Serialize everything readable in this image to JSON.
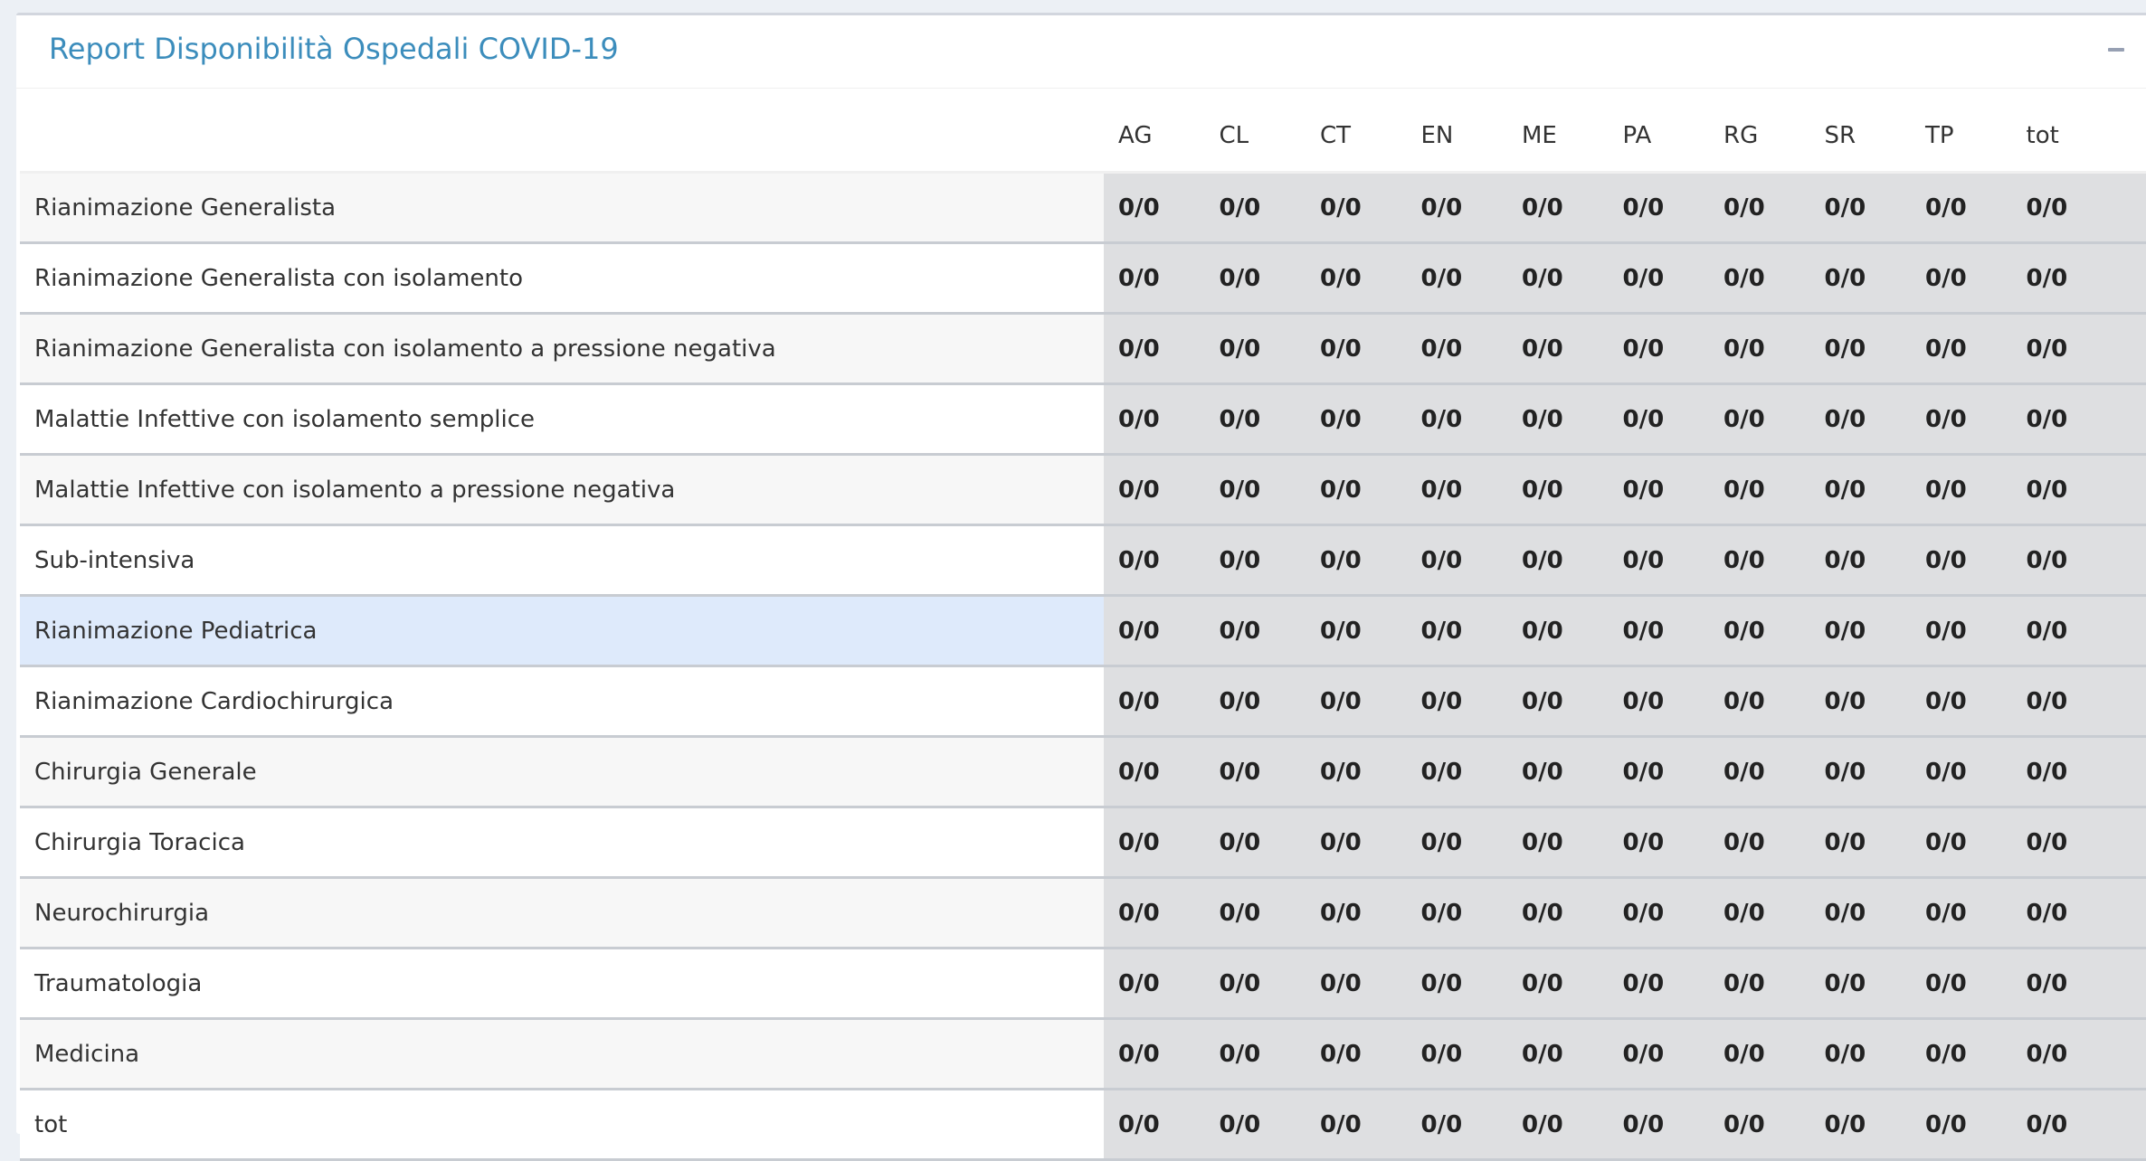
{
  "box": {
    "title": "Report Disponibilità Ospedali COVID-19",
    "collapse_icon": "minus-icon"
  },
  "table": {
    "columns": [
      "AG",
      "CL",
      "CT",
      "EN",
      "ME",
      "PA",
      "RG",
      "SR",
      "TP",
      "tot"
    ],
    "rows": [
      {
        "label": "Rianimazione Generalista",
        "values": [
          "0/0",
          "0/0",
          "0/0",
          "0/0",
          "0/0",
          "0/0",
          "0/0",
          "0/0",
          "0/0",
          "0/0"
        ]
      },
      {
        "label": "Rianimazione Generalista con isolamento",
        "values": [
          "0/0",
          "0/0",
          "0/0",
          "0/0",
          "0/0",
          "0/0",
          "0/0",
          "0/0",
          "0/0",
          "0/0"
        ]
      },
      {
        "label": "Rianimazione Generalista con isolamento a pressione negativa",
        "values": [
          "0/0",
          "0/0",
          "0/0",
          "0/0",
          "0/0",
          "0/0",
          "0/0",
          "0/0",
          "0/0",
          "0/0"
        ]
      },
      {
        "label": "Malattie Infettive con isolamento semplice",
        "values": [
          "0/0",
          "0/0",
          "0/0",
          "0/0",
          "0/0",
          "0/0",
          "0/0",
          "0/0",
          "0/0",
          "0/0"
        ]
      },
      {
        "label": "Malattie Infettive con isolamento a pressione negativa",
        "values": [
          "0/0",
          "0/0",
          "0/0",
          "0/0",
          "0/0",
          "0/0",
          "0/0",
          "0/0",
          "0/0",
          "0/0"
        ]
      },
      {
        "label": "Sub-intensiva",
        "values": [
          "0/0",
          "0/0",
          "0/0",
          "0/0",
          "0/0",
          "0/0",
          "0/0",
          "0/0",
          "0/0",
          "0/0"
        ]
      },
      {
        "label": "Rianimazione Pediatrica",
        "values": [
          "0/0",
          "0/0",
          "0/0",
          "0/0",
          "0/0",
          "0/0",
          "0/0",
          "0/0",
          "0/0",
          "0/0"
        ],
        "highlighted": true
      },
      {
        "label": "Rianimazione Cardiochirurgica",
        "values": [
          "0/0",
          "0/0",
          "0/0",
          "0/0",
          "0/0",
          "0/0",
          "0/0",
          "0/0",
          "0/0",
          "0/0"
        ]
      },
      {
        "label": "Chirurgia Generale",
        "values": [
          "0/0",
          "0/0",
          "0/0",
          "0/0",
          "0/0",
          "0/0",
          "0/0",
          "0/0",
          "0/0",
          "0/0"
        ]
      },
      {
        "label": "Chirurgia Toracica",
        "values": [
          "0/0",
          "0/0",
          "0/0",
          "0/0",
          "0/0",
          "0/0",
          "0/0",
          "0/0",
          "0/0",
          "0/0"
        ]
      },
      {
        "label": "Neurochirurgia",
        "values": [
          "0/0",
          "0/0",
          "0/0",
          "0/0",
          "0/0",
          "0/0",
          "0/0",
          "0/0",
          "0/0",
          "0/0"
        ]
      },
      {
        "label": "Traumatologia",
        "values": [
          "0/0",
          "0/0",
          "0/0",
          "0/0",
          "0/0",
          "0/0",
          "0/0",
          "0/0",
          "0/0",
          "0/0"
        ]
      },
      {
        "label": "Medicina",
        "values": [
          "0/0",
          "0/0",
          "0/0",
          "0/0",
          "0/0",
          "0/0",
          "0/0",
          "0/0",
          "0/0",
          "0/0"
        ]
      },
      {
        "label": "tot",
        "values": [
          "0/0",
          "0/0",
          "0/0",
          "0/0",
          "0/0",
          "0/0",
          "0/0",
          "0/0",
          "0/0",
          "0/0"
        ]
      }
    ]
  }
}
